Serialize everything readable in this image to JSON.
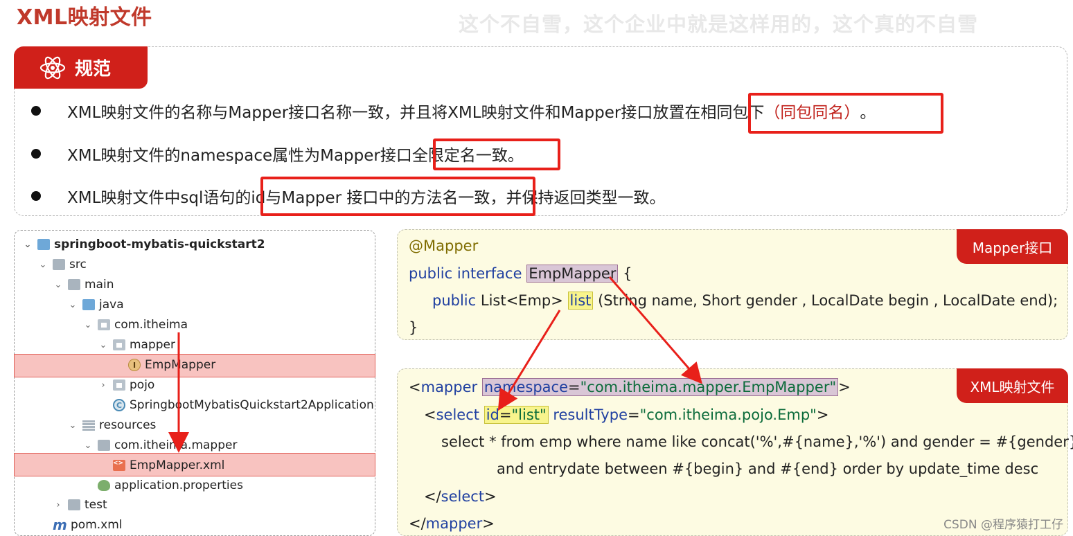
{
  "header": {
    "title": "XML映射文件",
    "watermark": "这个不自雪，这个企业中就是这样用的，这个真的不自雪"
  },
  "spec": {
    "tab_label": "规范",
    "rules": [
      {
        "before": "XML映射文件的名称与Mapper接口名称一致，并且将XML映射文件和Mapper接口放置在",
        "boxed": "相同包下",
        "red": "（同包同名）",
        "after": "。"
      },
      {
        "before": "XML映射文件的namespace属性为Mapper接口",
        "boxed": "全限定名一致。",
        "after": ""
      },
      {
        "before": "XML映射文件中sql语句的",
        "boxed": "id与Mapper 接口中的方法名一致，",
        "after": "并保持返回类型一致。"
      }
    ]
  },
  "tree": {
    "items": [
      {
        "label": "springboot-mybatis-quickstart2",
        "chev": "⌄",
        "icon": "module-folder-icon"
      },
      {
        "label": "src",
        "chev": "⌄",
        "icon": "folder-icon"
      },
      {
        "label": "main",
        "chev": "⌄",
        "icon": "folder-icon"
      },
      {
        "label": "java",
        "chev": "⌄",
        "icon": "source-folder-icon"
      },
      {
        "label": "com.itheima",
        "chev": "⌄",
        "icon": "package-icon"
      },
      {
        "label": "mapper",
        "chev": "⌄",
        "icon": "package-icon"
      },
      {
        "label": "EmpMapper",
        "chev": "",
        "icon": "interface-icon",
        "icon_letter": "I"
      },
      {
        "label": "pojo",
        "chev": "›",
        "icon": "package-icon"
      },
      {
        "label": "SpringbootMybatisQuickstart2Application",
        "chev": "",
        "icon": "class-icon",
        "icon_letter": "C"
      },
      {
        "label": "resources",
        "chev": "⌄",
        "icon": "resources-folder-icon"
      },
      {
        "label": "com.itheima.mapper",
        "chev": "⌄",
        "icon": "folder-icon"
      },
      {
        "label": "EmpMapper.xml",
        "chev": "",
        "icon": "xml-file-icon",
        "icon_letter": "<>"
      },
      {
        "label": "application.properties",
        "chev": "",
        "icon": "properties-icon"
      },
      {
        "label": "test",
        "chev": "›",
        "icon": "folder-icon"
      },
      {
        "label": "pom.xml",
        "chev": "",
        "icon": "maven-icon",
        "icon_letter": "m"
      }
    ]
  },
  "mapper_code": {
    "tag": "Mapper接口",
    "annotation": "@Mapper",
    "line2_kw": "public interface",
    "line2_name": "EmpMapper",
    "line2_brace": "{",
    "line3_kw": "public",
    "line3_type": "List<Emp>",
    "line3_method": "list",
    "line3_params": "(String name, Short gender , LocalDate begin , LocalDate end);",
    "close": "}"
  },
  "xml_code": {
    "tag": "XML映射文件",
    "l1_open": "<",
    "l1_tag": "mapper",
    "l1_attr": "namespace",
    "l1_eq": "=",
    "l1_val": "\"com.itheima.mapper.EmpMapper\"",
    "l1_close": ">",
    "l2_open": "<",
    "l2_tag": "select",
    "l2_id_attr": "id",
    "l2_id_eq": "=",
    "l2_id_val": "\"list\"",
    "l2_rt_attr": "resultType",
    "l2_rt_eq": "=",
    "l2_rt_val": "\"com.itheima.pojo.Emp\"",
    "l2_close": ">",
    "l3": "select * from emp where name like concat('%',#{name},'%') and gender = #{gender}",
    "l4": "and entrydate between #{begin} and #{end} order by update_time desc",
    "l5_open": "</",
    "l5_tag": "select",
    "l5_close": ">",
    "l6_open": "</",
    "l6_tag": "mapper",
    "l6_close": ">"
  },
  "footer": {
    "credit": "CSDN @程序猿打工仔"
  },
  "colors": {
    "accent_red": "#d0201a",
    "code_bg": "#fdfbe2",
    "highlight_row": "#f8c3c0"
  }
}
